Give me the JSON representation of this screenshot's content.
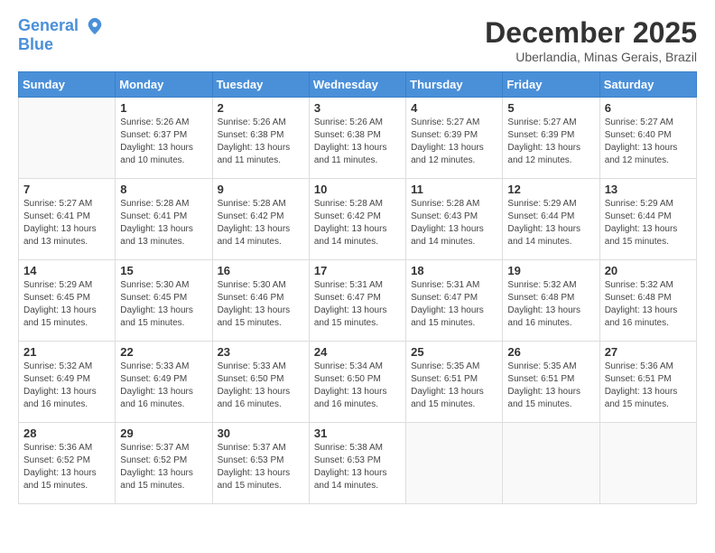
{
  "header": {
    "logo_line1": "General",
    "logo_line2": "Blue",
    "title": "December 2025",
    "subtitle": "Uberlandia, Minas Gerais, Brazil"
  },
  "days_of_week": [
    "Sunday",
    "Monday",
    "Tuesday",
    "Wednesday",
    "Thursday",
    "Friday",
    "Saturday"
  ],
  "weeks": [
    [
      {
        "day": "",
        "info": ""
      },
      {
        "day": "1",
        "info": "Sunrise: 5:26 AM\nSunset: 6:37 PM\nDaylight: 13 hours\nand 10 minutes."
      },
      {
        "day": "2",
        "info": "Sunrise: 5:26 AM\nSunset: 6:38 PM\nDaylight: 13 hours\nand 11 minutes."
      },
      {
        "day": "3",
        "info": "Sunrise: 5:26 AM\nSunset: 6:38 PM\nDaylight: 13 hours\nand 11 minutes."
      },
      {
        "day": "4",
        "info": "Sunrise: 5:27 AM\nSunset: 6:39 PM\nDaylight: 13 hours\nand 12 minutes."
      },
      {
        "day": "5",
        "info": "Sunrise: 5:27 AM\nSunset: 6:39 PM\nDaylight: 13 hours\nand 12 minutes."
      },
      {
        "day": "6",
        "info": "Sunrise: 5:27 AM\nSunset: 6:40 PM\nDaylight: 13 hours\nand 12 minutes."
      }
    ],
    [
      {
        "day": "7",
        "info": "Sunrise: 5:27 AM\nSunset: 6:41 PM\nDaylight: 13 hours\nand 13 minutes."
      },
      {
        "day": "8",
        "info": "Sunrise: 5:28 AM\nSunset: 6:41 PM\nDaylight: 13 hours\nand 13 minutes."
      },
      {
        "day": "9",
        "info": "Sunrise: 5:28 AM\nSunset: 6:42 PM\nDaylight: 13 hours\nand 14 minutes."
      },
      {
        "day": "10",
        "info": "Sunrise: 5:28 AM\nSunset: 6:42 PM\nDaylight: 13 hours\nand 14 minutes."
      },
      {
        "day": "11",
        "info": "Sunrise: 5:28 AM\nSunset: 6:43 PM\nDaylight: 13 hours\nand 14 minutes."
      },
      {
        "day": "12",
        "info": "Sunrise: 5:29 AM\nSunset: 6:44 PM\nDaylight: 13 hours\nand 14 minutes."
      },
      {
        "day": "13",
        "info": "Sunrise: 5:29 AM\nSunset: 6:44 PM\nDaylight: 13 hours\nand 15 minutes."
      }
    ],
    [
      {
        "day": "14",
        "info": "Sunrise: 5:29 AM\nSunset: 6:45 PM\nDaylight: 13 hours\nand 15 minutes."
      },
      {
        "day": "15",
        "info": "Sunrise: 5:30 AM\nSunset: 6:45 PM\nDaylight: 13 hours\nand 15 minutes."
      },
      {
        "day": "16",
        "info": "Sunrise: 5:30 AM\nSunset: 6:46 PM\nDaylight: 13 hours\nand 15 minutes."
      },
      {
        "day": "17",
        "info": "Sunrise: 5:31 AM\nSunset: 6:47 PM\nDaylight: 13 hours\nand 15 minutes."
      },
      {
        "day": "18",
        "info": "Sunrise: 5:31 AM\nSunset: 6:47 PM\nDaylight: 13 hours\nand 15 minutes."
      },
      {
        "day": "19",
        "info": "Sunrise: 5:32 AM\nSunset: 6:48 PM\nDaylight: 13 hours\nand 16 minutes."
      },
      {
        "day": "20",
        "info": "Sunrise: 5:32 AM\nSunset: 6:48 PM\nDaylight: 13 hours\nand 16 minutes."
      }
    ],
    [
      {
        "day": "21",
        "info": "Sunrise: 5:32 AM\nSunset: 6:49 PM\nDaylight: 13 hours\nand 16 minutes."
      },
      {
        "day": "22",
        "info": "Sunrise: 5:33 AM\nSunset: 6:49 PM\nDaylight: 13 hours\nand 16 minutes."
      },
      {
        "day": "23",
        "info": "Sunrise: 5:33 AM\nSunset: 6:50 PM\nDaylight: 13 hours\nand 16 minutes."
      },
      {
        "day": "24",
        "info": "Sunrise: 5:34 AM\nSunset: 6:50 PM\nDaylight: 13 hours\nand 16 minutes."
      },
      {
        "day": "25",
        "info": "Sunrise: 5:35 AM\nSunset: 6:51 PM\nDaylight: 13 hours\nand 15 minutes."
      },
      {
        "day": "26",
        "info": "Sunrise: 5:35 AM\nSunset: 6:51 PM\nDaylight: 13 hours\nand 15 minutes."
      },
      {
        "day": "27",
        "info": "Sunrise: 5:36 AM\nSunset: 6:51 PM\nDaylight: 13 hours\nand 15 minutes."
      }
    ],
    [
      {
        "day": "28",
        "info": "Sunrise: 5:36 AM\nSunset: 6:52 PM\nDaylight: 13 hours\nand 15 minutes."
      },
      {
        "day": "29",
        "info": "Sunrise: 5:37 AM\nSunset: 6:52 PM\nDaylight: 13 hours\nand 15 minutes."
      },
      {
        "day": "30",
        "info": "Sunrise: 5:37 AM\nSunset: 6:53 PM\nDaylight: 13 hours\nand 15 minutes."
      },
      {
        "day": "31",
        "info": "Sunrise: 5:38 AM\nSunset: 6:53 PM\nDaylight: 13 hours\nand 14 minutes."
      },
      {
        "day": "",
        "info": ""
      },
      {
        "day": "",
        "info": ""
      },
      {
        "day": "",
        "info": ""
      }
    ]
  ]
}
